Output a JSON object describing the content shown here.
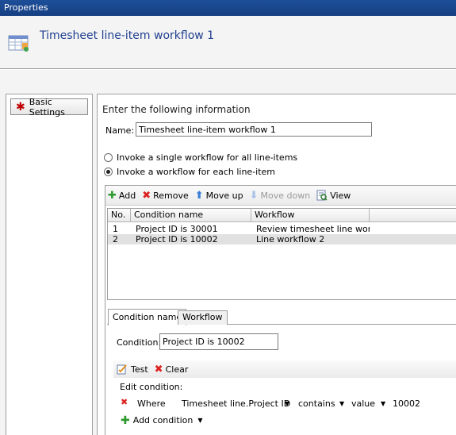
{
  "window": {
    "title": "Properties"
  },
  "header": {
    "title": "Timesheet line-item workflow 1",
    "icon": "timesheet-grid-icon"
  },
  "nav": {
    "items": [
      {
        "label": "Basic Settings",
        "icon": "required-star-icon"
      }
    ]
  },
  "form": {
    "intro": "Enter the following information",
    "name_label": "Name:",
    "name_value": "Timesheet line-item workflow 1",
    "radio_single": "Invoke a single workflow for all line-items",
    "radio_each": "Invoke a workflow for each line-item",
    "selected_option": "each"
  },
  "toolbar": {
    "add": "Add",
    "remove": "Remove",
    "move_up": "Move up",
    "move_down": "Move down",
    "view": "View"
  },
  "table": {
    "columns": [
      "No.",
      "Condition name",
      "Workflow"
    ],
    "rows": [
      {
        "no": "1",
        "condition": "Project ID is 30001",
        "workflow": "Review timesheet line workfl"
      },
      {
        "no": "2",
        "condition": "Project ID is 10002",
        "workflow": "Line workflow 2"
      }
    ],
    "selected_row": 2
  },
  "tabs": {
    "condition_name": "Condition name",
    "workflow": "Workflow",
    "active": "condition_name"
  },
  "condition": {
    "label": "Condition:",
    "value": "Project ID is 10002",
    "test": "Test",
    "clear": "Clear",
    "edit_label": "Edit condition:",
    "where": "Where",
    "field": "Timesheet line.Project ID",
    "operator": "contains",
    "value_type": "value",
    "operand": "10002",
    "add_condition": "Add condition"
  },
  "colors": {
    "title_bar": "#1d4f99",
    "header_title": "#1f3f8f",
    "selected_row": "#e1e1e1"
  }
}
